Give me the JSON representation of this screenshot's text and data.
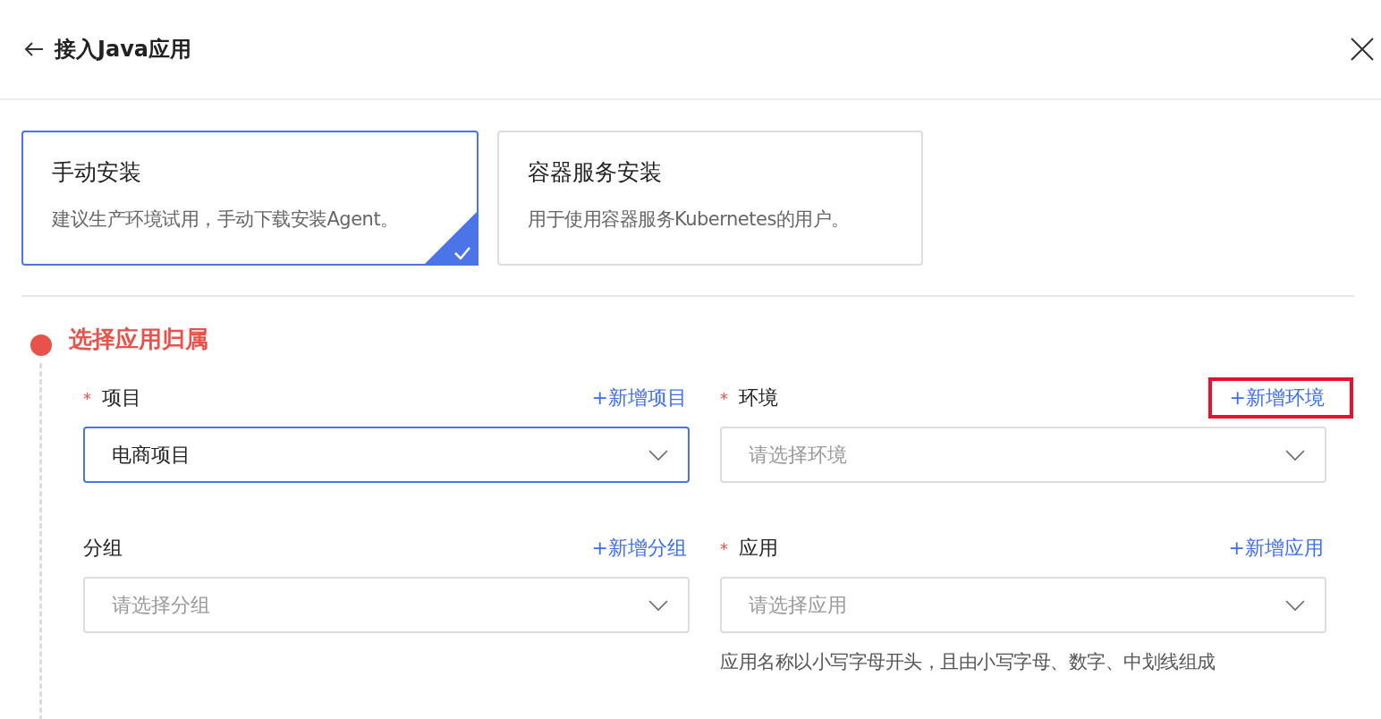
{
  "header": {
    "title": "接入Java应用"
  },
  "install_options": [
    {
      "title": "手动安装",
      "description": "建议生产环境试用，手动下载安装Agent。",
      "selected": true
    },
    {
      "title": "容器服务安装",
      "description": "用于使用容器服务Kubernetes的用户。",
      "selected": false
    }
  ],
  "step": {
    "title": "选择应用归属",
    "fields": [
      {
        "label": "项目",
        "required_mark": "*",
        "add_link": "+新增项目",
        "highlighted": false,
        "value": "电商项目",
        "focused": true
      },
      {
        "label": "环境",
        "required_mark": "*",
        "add_link": "+新增环境",
        "highlighted": true,
        "placeholder": "请选择环境",
        "focused": false
      },
      {
        "label": "分组",
        "add_link": "+新增分组",
        "highlighted": false,
        "placeholder": "请选择分组",
        "focused": false
      },
      {
        "label": "应用",
        "required_mark": "*",
        "add_link": "+新增应用",
        "highlighted": false,
        "placeholder": "请选择应用",
        "focused": false,
        "hint": "应用名称以小写字母开头，且由小写字母、数字、中划线组成"
      }
    ]
  }
}
